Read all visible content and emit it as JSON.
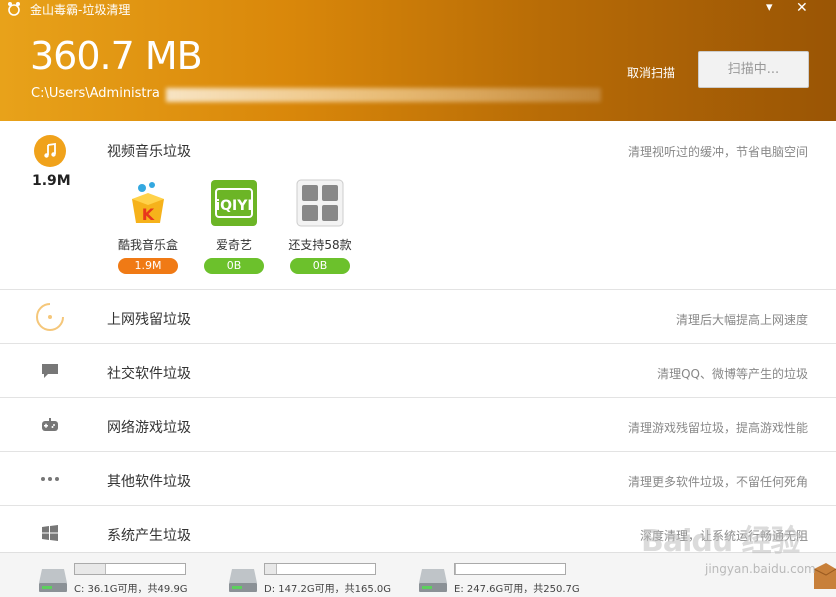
{
  "window": {
    "title": "金山毒霸-垃圾清理",
    "minimize_glyph": "▾",
    "close_glyph": "✕"
  },
  "scan": {
    "total_size": "360.7 MB",
    "current_path": "C:\\Users\\Administra",
    "cancel_label": "取消扫描",
    "button_label": "扫描中..."
  },
  "categories": [
    {
      "title": "视频音乐垃圾",
      "desc": "清理视听过的缓冲，节省电脑空间",
      "size": "1.9M",
      "icon": "music-note-icon",
      "apps": [
        {
          "name": "酷我音乐盒",
          "badge": "1.9M",
          "badge_color": "#f07a15",
          "icon": "kuwo-icon"
        },
        {
          "name": "爱奇艺",
          "badge": "0B",
          "badge_color": "#6cc12c",
          "icon": "iqiyi-icon"
        },
        {
          "name": "还支持58款",
          "badge": "0B",
          "badge_color": "#6cc12c",
          "icon": "more-apps-icon"
        }
      ]
    },
    {
      "title": "上网残留垃圾",
      "desc": "清理后大幅提高上网速度",
      "icon": "loading-spinner-icon"
    },
    {
      "title": "社交软件垃圾",
      "desc": "清理QQ、微博等产生的垃圾",
      "icon": "chat-bubble-icon"
    },
    {
      "title": "网络游戏垃圾",
      "desc": "清理游戏残留垃圾，提高游戏性能",
      "icon": "gamepad-icon"
    },
    {
      "title": "其他软件垃圾",
      "desc": "清理更多软件垃圾，不留任何死角",
      "icon": "ellipsis-icon"
    },
    {
      "title": "系统产生垃圾",
      "desc": "深度清理，让系统运行畅通无阻",
      "icon": "windows-icon"
    }
  ],
  "drives": [
    {
      "label": "C: 36.1G可用，共49.9G",
      "used_fraction": 0.28
    },
    {
      "label": "D: 147.2G可用，共165.0G",
      "used_fraction": 0.11
    },
    {
      "label": "E: 247.6G可用，共250.7G",
      "used_fraction": 0.01
    }
  ],
  "watermark": {
    "main": "Baidu 经验",
    "sub": "jingyan.baidu.com"
  },
  "colors": {
    "header_start": "#e8a21a",
    "header_end": "#9a5505",
    "accent": "#f0a21b",
    "badge_orange": "#f07a15",
    "badge_green": "#6cc12c"
  }
}
